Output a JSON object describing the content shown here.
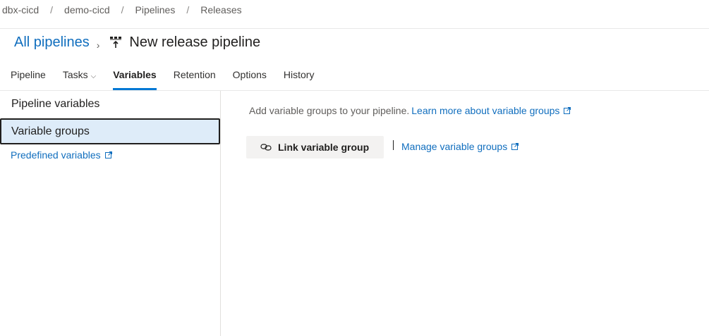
{
  "breadcrumb": {
    "items": [
      "dbx-cicd",
      "demo-cicd",
      "Pipelines",
      "Releases"
    ],
    "separator": "/"
  },
  "header": {
    "all_pipelines_label": "All pipelines",
    "chevron": "›",
    "pipeline_name": "New release pipeline"
  },
  "tabs": [
    {
      "label": "Pipeline"
    },
    {
      "label": "Tasks",
      "caret": "⌵"
    },
    {
      "label": "Variables",
      "active": true
    },
    {
      "label": "Retention"
    },
    {
      "label": "Options"
    },
    {
      "label": "History"
    }
  ],
  "sidebar": {
    "items": [
      {
        "label": "Pipeline variables"
      },
      {
        "label": "Variable groups",
        "selected": true
      }
    ],
    "predefined_link": "Predefined variables"
  },
  "main": {
    "description": "Add variable groups to your pipeline.",
    "learn_more_link": "Learn more about variable groups",
    "link_button_label": "Link variable group",
    "manage_link": "Manage variable groups"
  },
  "colors": {
    "accent": "#0078d4",
    "link": "#106ebe",
    "selected_bg": "#deecf9",
    "button_bg": "#f3f2f1"
  },
  "icons": [
    "pipeline-icon",
    "external-link-icon",
    "link-icon",
    "chevron-right-icon",
    "chevron-down-icon"
  ]
}
